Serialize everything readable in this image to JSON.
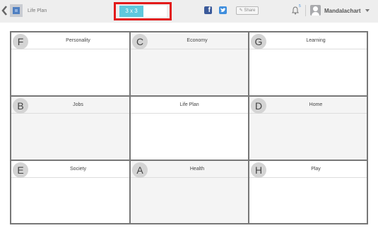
{
  "header": {
    "page_title": "Life Plan",
    "size_tab": "3 x 3",
    "facebook_glyph": "f",
    "share_label": "Share",
    "notification_count": "5",
    "username": "Mandalachart"
  },
  "highlight_color": "#e21a1a",
  "grid": {
    "cells": [
      {
        "letter": "F",
        "title": "Personality"
      },
      {
        "letter": "C",
        "title": "Economy"
      },
      {
        "letter": "G",
        "title": "Learning"
      },
      {
        "letter": "B",
        "title": "Jobs"
      },
      {
        "letter": "",
        "title": "Life Plan"
      },
      {
        "letter": "D",
        "title": "Home"
      },
      {
        "letter": "E",
        "title": "Society"
      },
      {
        "letter": "A",
        "title": "Health"
      },
      {
        "letter": "H",
        "title": "Play"
      }
    ]
  }
}
